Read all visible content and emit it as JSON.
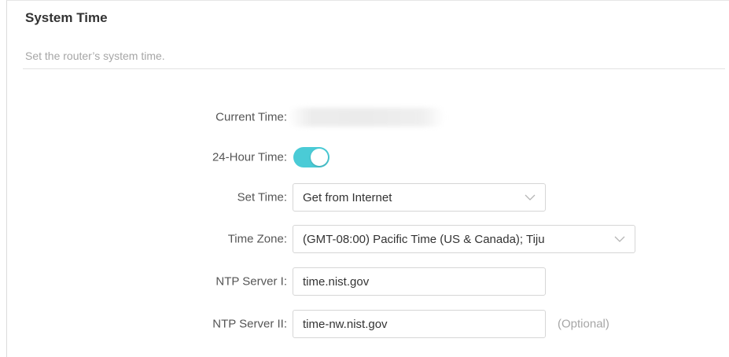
{
  "section": {
    "title": "System Time",
    "subtitle": "Set the router’s system time."
  },
  "form": {
    "current_time": {
      "label": "Current Time:"
    },
    "hour24": {
      "label": "24-Hour Time:",
      "enabled": true
    },
    "set_time": {
      "label": "Set Time:",
      "value": "Get from Internet"
    },
    "time_zone": {
      "label": "Time Zone:",
      "value": "(GMT-08:00) Pacific Time (US & Canada); Tiju"
    },
    "ntp1": {
      "label": "NTP Server I:",
      "value": "time.nist.gov"
    },
    "ntp2": {
      "label": "NTP Server II:",
      "value": "time-nw.nist.gov",
      "hint": "(Optional)"
    }
  },
  "colors": {
    "accent": "#4acbd6",
    "muted_text": "#a6a6a6",
    "label_text": "#555555",
    "border": "#d6d6d6"
  },
  "icons": {
    "dropdown": "chevron-down-icon"
  }
}
